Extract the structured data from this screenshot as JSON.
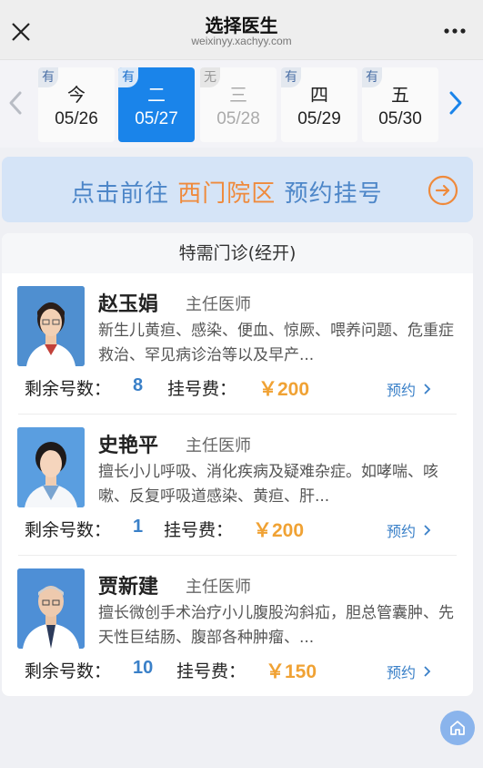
{
  "header": {
    "title": "选择医生",
    "subtitle": "weixinyy.xachyy.com"
  },
  "dates": [
    {
      "badge": "有",
      "weekday": "今",
      "date": "05/26",
      "state": "normal"
    },
    {
      "badge": "有",
      "weekday": "二",
      "date": "05/27",
      "state": "selected"
    },
    {
      "badge": "无",
      "weekday": "三",
      "date": "05/28",
      "state": "disabled"
    },
    {
      "badge": "有",
      "weekday": "四",
      "date": "05/29",
      "state": "normal"
    },
    {
      "badge": "有",
      "weekday": "五",
      "date": "05/30",
      "state": "normal"
    }
  ],
  "banner": {
    "prefix": "点击前往",
    "campus": "西门院区",
    "suffix": "预约挂号"
  },
  "section": {
    "title": "特需门诊(经开)"
  },
  "labels": {
    "remaining": "剩余号数：",
    "fee": "挂号费：",
    "book": "预约"
  },
  "doctors": [
    {
      "name": "赵玉娟",
      "title": "主任医师",
      "description": "新生儿黄疸、感染、便血、惊厥、喂养问题、危重症救治、罕见病诊治等以及早产...",
      "remaining": "8",
      "fee": "￥200"
    },
    {
      "name": "史艳平",
      "title": "主任医师",
      "description": "擅长小儿呼吸、消化疾病及疑难杂症。如哮喘、咳嗽、反复呼吸道感染、黄疸、肝...",
      "remaining": "1",
      "fee": "￥200"
    },
    {
      "name": "贾新建",
      "title": "主任医师",
      "description": "擅长微创手术治疗小儿腹股沟斜疝，胆总管囊肿、先天性巨结肠、腹部各种肿瘤、...",
      "remaining": "10",
      "fee": "￥150"
    }
  ],
  "colors": {
    "accent_blue": "#1a84ea",
    "link_blue": "#3a80c8",
    "orange": "#ef8a3c",
    "fee_orange": "#f0a234"
  },
  "icons": {
    "close": "close-icon",
    "more": "more-icon",
    "prev": "chevron-left-icon",
    "next": "chevron-right-icon",
    "go": "arrow-right-circle-icon",
    "home": "home-icon"
  }
}
